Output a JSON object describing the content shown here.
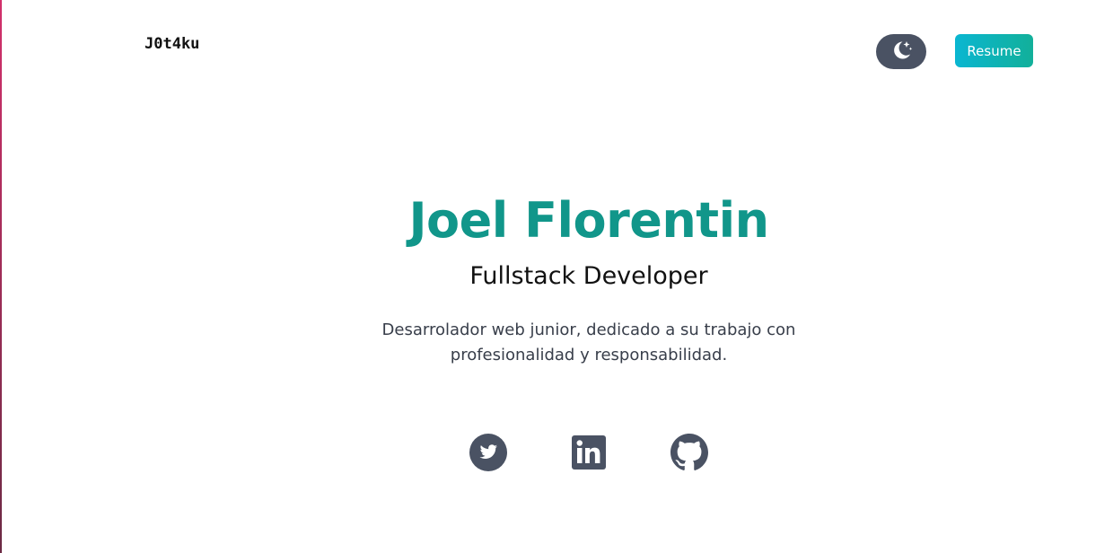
{
  "header": {
    "logo_text": "J0t4ku",
    "theme_toggle_icon": "moon-stars-icon",
    "resume_label": "Resume"
  },
  "hero": {
    "name": "Joel Florentin",
    "role": "Fullstack Developer",
    "description": "Desarrolador web junior, dedicado a su trabajo con profesionalidad y responsabilidad."
  },
  "social": [
    {
      "icon": "twitter-icon"
    },
    {
      "icon": "linkedin-icon"
    },
    {
      "icon": "github-icon"
    }
  ],
  "colors": {
    "accent": "#11968a",
    "icon": "#4a5263",
    "resume_gradient_start": "#0ab6d1",
    "resume_gradient_end": "#12b09a",
    "left_edge_top": "#d2306b",
    "left_edge_bottom": "#6b2a44"
  }
}
